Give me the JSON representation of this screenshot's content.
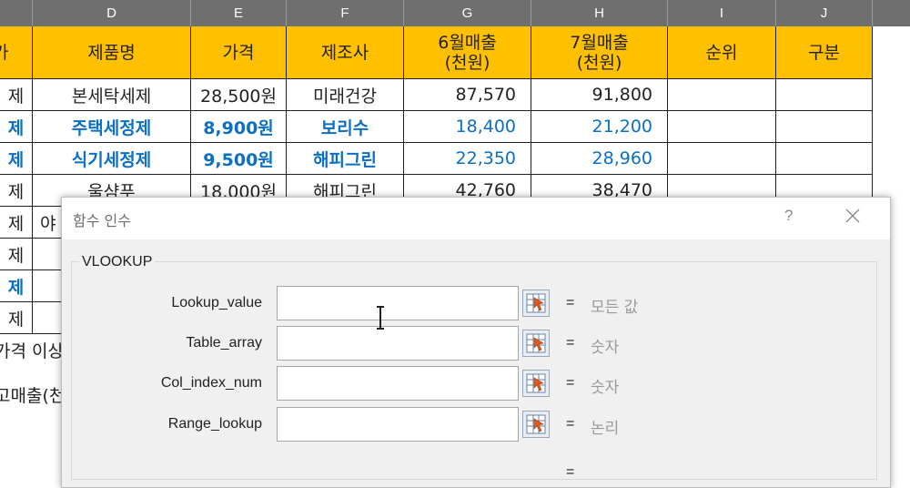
{
  "columns": [
    "D",
    "E",
    "F",
    "G",
    "H",
    "I",
    "J"
  ],
  "headers": {
    "c": "가",
    "d": "제품명",
    "e": "가격",
    "f": "제조사",
    "g1": "6월매출",
    "g2": "(천원)",
    "h1": "7월매출",
    "h2": "(천원)",
    "i": "순위",
    "j": "구분"
  },
  "rows": [
    {
      "c": "제",
      "d": "본세탁세제",
      "e": "28,500원",
      "f": "미래건강",
      "g": "87,570",
      "h": "91,800",
      "blue": false
    },
    {
      "c": "제",
      "d": "주택세정제",
      "e": "8,900원",
      "f": "보리수",
      "g": "18,400",
      "h": "21,200",
      "blue": true
    },
    {
      "c": "제",
      "d": "식기세정제",
      "e": "9,500원",
      "f": "해피그린",
      "g": "22,350",
      "h": "28,960",
      "blue": true
    },
    {
      "c": "제",
      "d": "울샴푸",
      "e": "18,000원",
      "f": "해피그린",
      "g": "42,760",
      "h": "38,470",
      "blue": false
    },
    {
      "c": "제",
      "d": "야",
      "blue": false
    },
    {
      "c": "제",
      "blue": false
    },
    {
      "c": "제",
      "blue": true
    },
    {
      "c": "제",
      "blue": false
    }
  ],
  "below": {
    "row1": "가격 이상",
    "row2": "고매출(천"
  },
  "dialog": {
    "title": "함수 인수",
    "help": "?",
    "function_name": "VLOOKUP",
    "args": [
      {
        "label": "Lookup_value",
        "value": "모든 값",
        "input": ""
      },
      {
        "label": "Table_array",
        "value": "숫자",
        "input": ""
      },
      {
        "label": "Col_index_num",
        "value": "숫자",
        "input": ""
      },
      {
        "label": "Range_lookup",
        "value": "논리",
        "input": ""
      }
    ],
    "equals": "=",
    "result": ""
  },
  "colors": {
    "header_fill": "#ffc000",
    "col_header": "#6f6f6f",
    "blue_text": "#0b6fc2",
    "dialog_bg": "#f0f0f0"
  }
}
